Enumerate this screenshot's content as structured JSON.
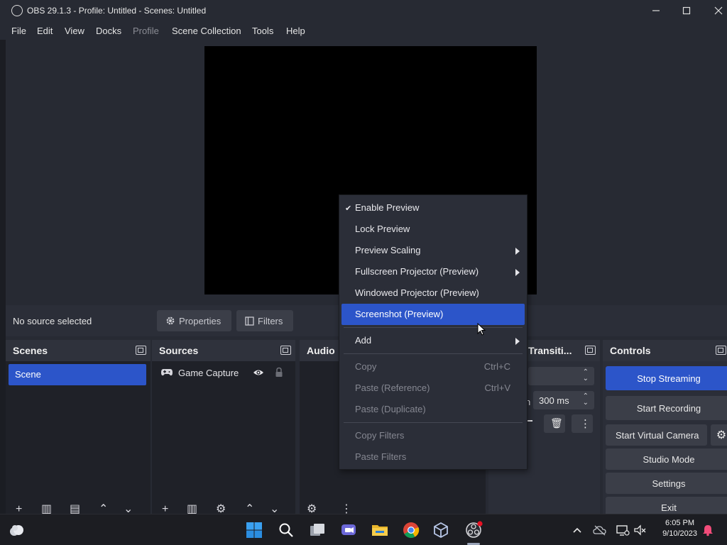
{
  "window": {
    "title": "OBS 29.1.3 - Profile: Untitled - Scenes: Untitled"
  },
  "menu": {
    "items": [
      "File",
      "Edit",
      "View",
      "Docks",
      "Profile",
      "Scene Collection",
      "Tools",
      "Help"
    ]
  },
  "source_bar": {
    "status": "No source selected",
    "properties_label": "Properties",
    "filters_label": "Filters"
  },
  "docks": {
    "scenes": {
      "title": "Scenes",
      "items": [
        "Scene"
      ]
    },
    "sources": {
      "title": "Sources",
      "items": [
        "Game Capture"
      ]
    },
    "audio": {
      "title": "Audio"
    },
    "transitions": {
      "title": "Transiti...",
      "duration": "300 ms",
      "duration_prefix": "n"
    },
    "controls": {
      "title": "Controls",
      "buttons": [
        "Stop Streaming",
        "Start Recording",
        "Start Virtual Camera",
        "Studio Mode",
        "Settings",
        "Exit"
      ]
    }
  },
  "context_menu": {
    "items": [
      {
        "label": "Enable Preview",
        "checked": true
      },
      {
        "label": "Lock Preview"
      },
      {
        "label": "Preview Scaling",
        "submenu": true
      },
      {
        "label": "Fullscreen Projector (Preview)",
        "submenu": true
      },
      {
        "label": "Windowed Projector (Preview)"
      },
      {
        "label": "Screenshot (Preview)",
        "highlighted": true
      },
      {
        "label": "Add",
        "submenu": true
      },
      {
        "label": "Copy",
        "shortcut": "Ctrl+C",
        "disabled": true
      },
      {
        "label": "Paste (Reference)",
        "shortcut": "Ctrl+V",
        "disabled": true
      },
      {
        "label": "Paste (Duplicate)",
        "disabled": true
      },
      {
        "label": "Copy Filters",
        "disabled": true
      },
      {
        "label": "Paste Filters",
        "disabled": true
      }
    ]
  },
  "taskbar": {
    "time": "6:05 PM",
    "date": "9/10/2023"
  },
  "colors": {
    "accent": "#2c55c9",
    "window_bg": "#272a33",
    "panel_bg": "#2b2e38",
    "list_bg": "#1f2128"
  }
}
